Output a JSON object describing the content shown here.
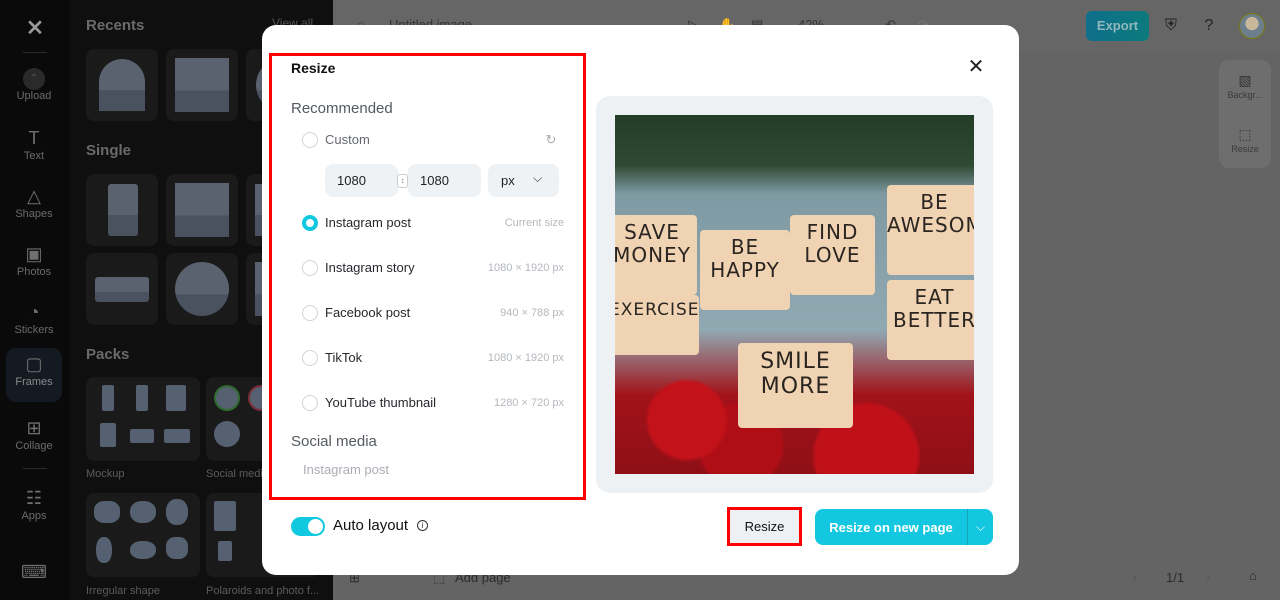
{
  "rail": {
    "logo": "capcut-logo",
    "items": [
      {
        "label": "Upload",
        "icon": "upload-icon"
      },
      {
        "label": "Text",
        "icon": "text-icon"
      },
      {
        "label": "Shapes",
        "icon": "shapes-icon"
      },
      {
        "label": "Photos",
        "icon": "photos-icon"
      },
      {
        "label": "Stickers",
        "icon": "stickers-icon"
      },
      {
        "label": "Frames",
        "icon": "frames-icon",
        "active": true
      },
      {
        "label": "Collage",
        "icon": "collage-icon"
      },
      {
        "label": "Apps",
        "icon": "apps-icon"
      }
    ]
  },
  "panel": {
    "recents_title": "Recents",
    "view_all": "View all",
    "single_title": "Single",
    "packs_title": "Packs",
    "packs": [
      {
        "label": "Mockup"
      },
      {
        "label": "Social media"
      },
      {
        "label": "Irregular shape"
      },
      {
        "label": "Polaroids and photo f..."
      }
    ]
  },
  "topbar": {
    "doc_title": "Untitled image",
    "zoom": "42%",
    "export_label": "Export"
  },
  "right_tools": [
    {
      "label": "Backgr...",
      "icon": "background-icon"
    },
    {
      "label": "Resize",
      "icon": "resize-icon"
    }
  ],
  "bottombar": {
    "add_page": "Add page",
    "page_indicator": "1/1"
  },
  "modal": {
    "title": "Resize",
    "recommended_title": "Recommended",
    "custom_label": "Custom",
    "width_value": "1080",
    "height_value": "1080",
    "unit": "px",
    "options": [
      {
        "label": "Instagram post",
        "size": "Current size",
        "selected": true
      },
      {
        "label": "Instagram story",
        "size": "1080 × 1920 px",
        "selected": false
      },
      {
        "label": "Facebook post",
        "size": "940 × 788 px",
        "selected": false
      },
      {
        "label": "TikTok",
        "size": "1080 × 1920 px",
        "selected": false
      },
      {
        "label": "YouTube thumbnail",
        "size": "1280 × 720 px",
        "selected": false
      }
    ],
    "social_title": "Social media",
    "social_sub": "Instagram post",
    "preview_cards": [
      "SAVE MONEY",
      "BE HAPPY",
      "FIND LOVE",
      "BE AWESOME",
      "EXERCISE",
      "EAT BETTER",
      "SMILE MORE"
    ],
    "auto_layout_label": "Auto layout",
    "auto_layout_on": true,
    "resize_label": "Resize",
    "resize_new_page_label": "Resize on new page"
  },
  "colors": {
    "accent": "#12c7df",
    "highlight": "#ff0000"
  }
}
